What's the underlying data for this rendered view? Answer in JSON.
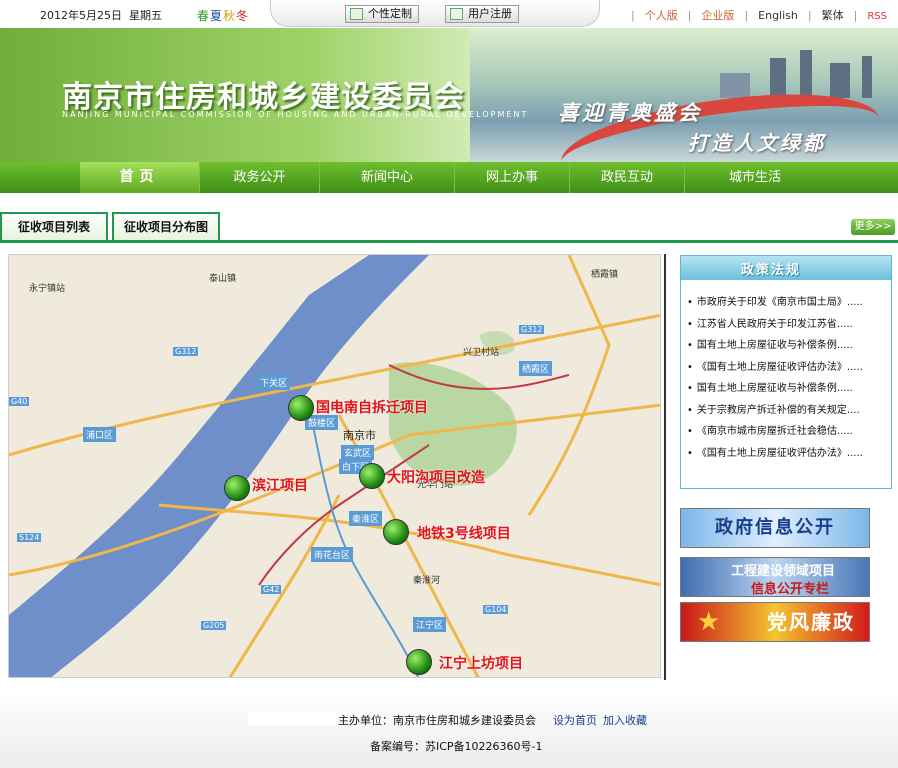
{
  "topbar": {
    "date": "2012年5月25日",
    "weekday": "星期五",
    "seasons": [
      {
        "text": "春",
        "color": "#2a9a2a"
      },
      {
        "text": "夏",
        "color": "#1a4fb0"
      },
      {
        "text": "秋",
        "color": "#c8a000"
      },
      {
        "text": "冬",
        "color": "#d22020"
      }
    ],
    "personalize_label": "个性定制",
    "register_label": "用户注册",
    "links": [
      "个人版",
      "企业版",
      "English",
      "繁体",
      "RSS"
    ]
  },
  "banner": {
    "title": "南京市住房和城乡建设委员会",
    "subtitle_en": "NANJING MUNICIPAL COMMISSION OF HOUSING AND URBAN-RURAL DEVELOPMENT",
    "slogan_1": "喜迎青奥盛会",
    "slogan_2": "打造人文绿都"
  },
  "nav": {
    "items": [
      "首页",
      "政务公开",
      "新闻中心",
      "网上办事",
      "政民互动",
      "城市生活"
    ],
    "active": "首页"
  },
  "tabs": {
    "items": [
      "征收项目列表",
      "征收项目分布图"
    ],
    "more_label": "更多>>"
  },
  "map": {
    "city_label": "南京市",
    "places": [
      "永宁镇站",
      "泰山镇",
      "栖霞镇",
      "兴卫村站",
      "栖霞区",
      "下关区",
      "鼓楼区",
      "玄武区",
      "白下区",
      "光华门站",
      "秦淮区",
      "雨花台区",
      "江宁区",
      "浦口区",
      "秦淮河"
    ],
    "highways": [
      "G312",
      "G40",
      "G312",
      "G42",
      "G205",
      "G104",
      "S124"
    ],
    "projects": [
      {
        "name": "国电南自拆迁项目"
      },
      {
        "name": "滨江项目"
      },
      {
        "name": "大阳沟项目改造"
      },
      {
        "name": "地铁3号线项目"
      },
      {
        "name": "江宁上坊项目"
      }
    ]
  },
  "policy": {
    "title": "政策法规",
    "items": [
      "市政府关于印发《南京市国土局》.....",
      "江苏省人民政府关于印发江苏省.....",
      "国有土地上房屋征收与补偿条例.....",
      "《国有土地上房屋征收评估办法》.....",
      "国有土地上房屋征收与补偿条例.....",
      "关于宗教房产拆迁补偿的有关规定....",
      "《南京市城市房屋拆迁社会稳估.....",
      "《国有土地上房屋征收评估办法》....."
    ]
  },
  "side_banners": {
    "gov_info": "政府信息公开",
    "engineering_line1": "工程建设领域项目",
    "engineering_line2": "信息公开专栏",
    "party": "党风廉政"
  },
  "footer": {
    "organizer": "主办单位：南京市住房和城乡建设委员会",
    "set_home": "设为首页",
    "add_favorite": "加入收藏",
    "icp": "备案编号：苏ICP备10226360号-1"
  }
}
